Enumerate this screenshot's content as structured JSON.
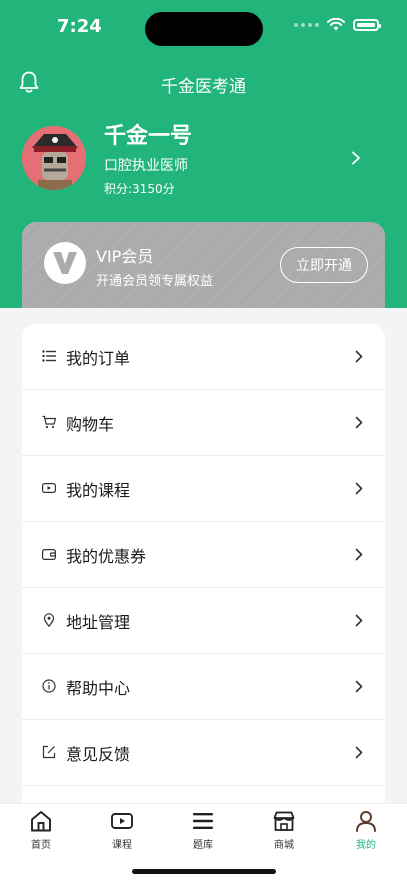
{
  "status_bar": {
    "time": "7:24"
  },
  "nav": {
    "title": "千金医考通"
  },
  "profile": {
    "name": "千金一号",
    "title": "口腔执业医师",
    "points": "积分:3150分"
  },
  "vip": {
    "logo_letter": "V",
    "title": "VIP会员",
    "subtitle": "开通会员领专属权益",
    "button_label": "立即开通"
  },
  "menu": {
    "items": [
      {
        "label": "我的订单",
        "icon": "list-icon"
      },
      {
        "label": "购物车",
        "icon": "cart-icon"
      },
      {
        "label": "我的课程",
        "icon": "video-icon"
      },
      {
        "label": "我的优惠券",
        "icon": "wallet-icon"
      },
      {
        "label": "地址管理",
        "icon": "location-pin-icon"
      },
      {
        "label": "帮助中心",
        "icon": "info-icon"
      },
      {
        "label": "意见反馈",
        "icon": "edit-icon"
      }
    ]
  },
  "tabs": [
    {
      "label": "首页",
      "icon": "home-icon"
    },
    {
      "label": "课程",
      "icon": "video-icon"
    },
    {
      "label": "题库",
      "icon": "menu-icon"
    },
    {
      "label": "商城",
      "icon": "store-icon"
    },
    {
      "label": "我的",
      "icon": "user-icon",
      "active": true
    }
  ],
  "colors": {
    "brand_green": "#22b57b",
    "vip_gray": "#a9abad",
    "background": "#f3f4f6"
  }
}
